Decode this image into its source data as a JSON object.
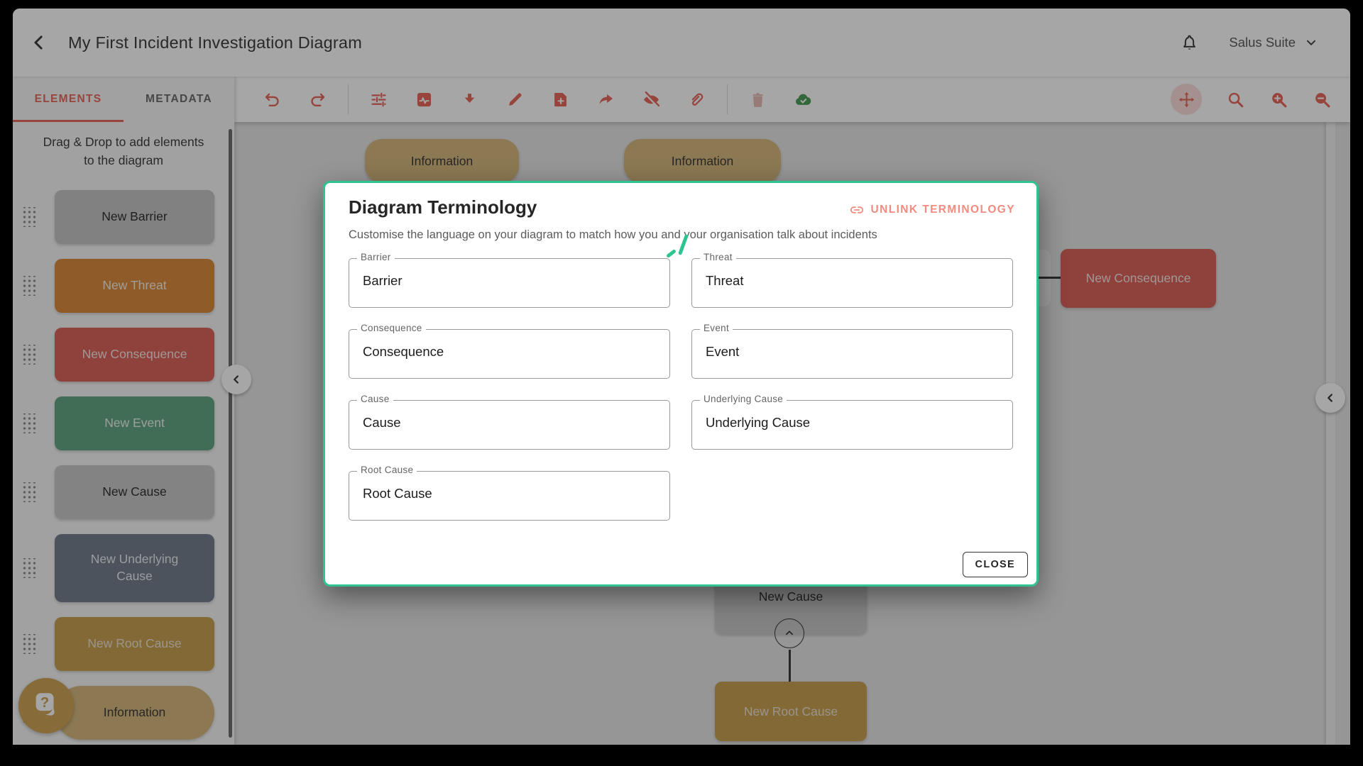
{
  "topbar": {
    "title": "My First Incident Investigation Diagram",
    "account_label": "Salus Suite"
  },
  "sidebar": {
    "tabs": [
      {
        "label": "ELEMENTS",
        "active": true
      },
      {
        "label": "METADATA",
        "active": false
      }
    ],
    "hint": "Drag & Drop to add elements to the diagram",
    "items": [
      {
        "label": "New Barrier",
        "bg": "#c6c6c6",
        "fg": "#323232"
      },
      {
        "label": "New Threat",
        "bg": "#dc8c3e",
        "fg": "#f7f1ea"
      },
      {
        "label": "New Consequence",
        "bg": "#dc655d",
        "fg": "#f8e9e6"
      },
      {
        "label": "New Event",
        "bg": "#64a783",
        "fg": "#eef5f0"
      },
      {
        "label": "New Cause",
        "bg": "#cacaca",
        "fg": "#323232"
      },
      {
        "label": "New Underlying Cause",
        "bg": "#75808e",
        "fg": "#edf0f3",
        "tall": true
      },
      {
        "label": "New Root Cause",
        "bg": "#c9a152",
        "fg": "#efe7d8"
      },
      {
        "label": "Information",
        "bg": "#d7ba80",
        "fg": "#3d3d3d",
        "pill": true
      }
    ]
  },
  "toolbar": {
    "left_icons": [
      "undo",
      "redo",
      "divider",
      "tune",
      "monitor",
      "download",
      "edit",
      "note-add",
      "share",
      "eye-off",
      "attach",
      "divider",
      "trash",
      "cloud-check"
    ],
    "right_icons": [
      "pan",
      "search",
      "zoom-in",
      "zoom-out"
    ]
  },
  "canvas": {
    "nodes": [
      {
        "id": "info-1",
        "label": "Information"
      },
      {
        "id": "info-2",
        "label": "Information"
      },
      {
        "id": "consequence",
        "label": "New Consequence"
      },
      {
        "id": "cause",
        "label": "New Cause"
      },
      {
        "id": "root-cause",
        "label": "New Root Cause"
      }
    ]
  },
  "modal": {
    "title": "Diagram Terminology",
    "unlink_label": "UNLINK TERMINOLOGY",
    "subtitle": "Customise the language on your diagram to match how you and your organisation talk about incidents",
    "fields": [
      {
        "label": "Barrier",
        "value": "Barrier"
      },
      {
        "label": "Threat",
        "value": "Threat"
      },
      {
        "label": "Consequence",
        "value": "Consequence"
      },
      {
        "label": "Event",
        "value": "Event"
      },
      {
        "label": "Cause",
        "value": "Cause"
      },
      {
        "label": "Underlying Cause",
        "value": "Underlying Cause"
      },
      {
        "label": "Root Cause",
        "value": "Root Cause"
      }
    ],
    "close_label": "CLOSE"
  },
  "colors": {
    "accent": "#e8695e",
    "modal_border": "#2ec48f",
    "unlink": "#f28b80",
    "cloud_green": "#4ea05a",
    "trash_disabled": "#e7bdb6",
    "canvas_bg": "#e7e7e7"
  }
}
